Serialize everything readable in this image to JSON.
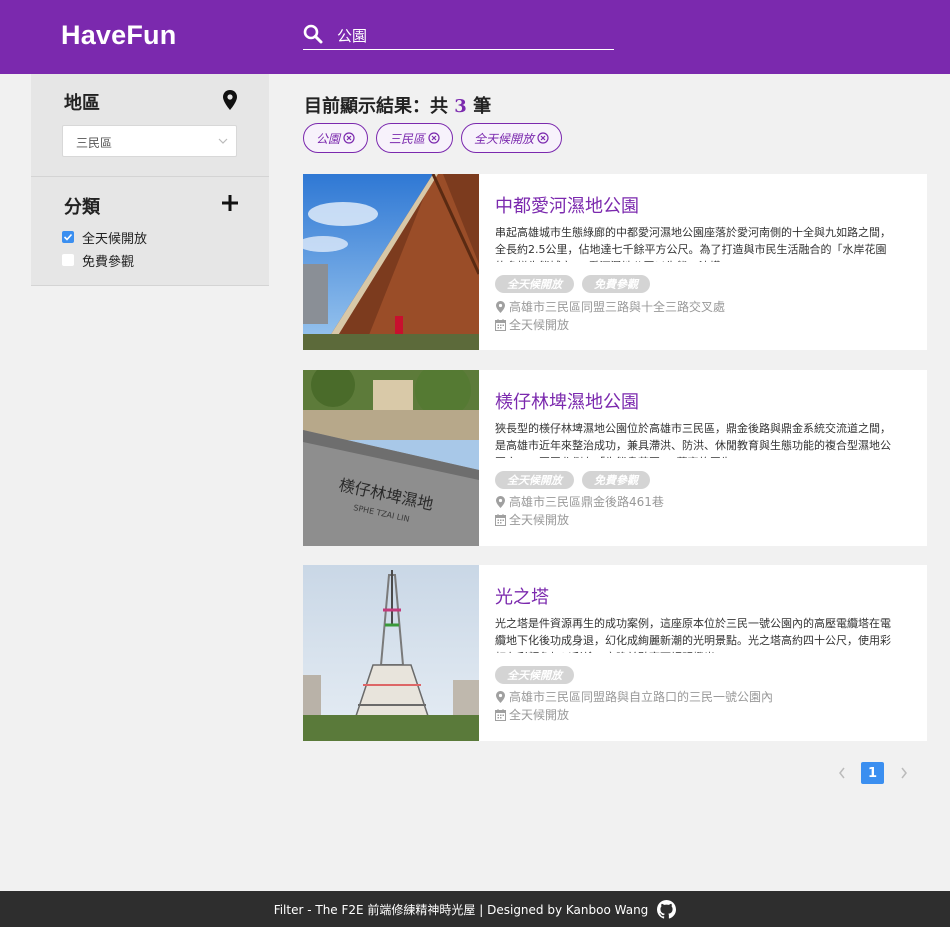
{
  "header": {
    "logo": "HaveFun",
    "search_value": "公園"
  },
  "sidebar": {
    "region_title": "地區",
    "region_select": "三民區",
    "category_title": "分類",
    "categories": [
      {
        "label": "全天候開放",
        "checked": true
      },
      {
        "label": "免費參觀",
        "checked": false
      }
    ]
  },
  "results": {
    "prefix": "目前顯示結果：共 ",
    "count": "3",
    "suffix": " 筆"
  },
  "filters": [
    "公園",
    "三民區",
    "全天候開放"
  ],
  "places": [
    {
      "name": "中都愛河濕地公園",
      "desc": "串起高雄城市生態綠廊的中都愛河濕地公園座落於愛河南側的十全與九如路之間，全長約2.5公里，佔地達七千餘平方公尺。為了打造與市民生活融合的「水岸花園的多樣生態城市」，愛河濕地公園以生態工法構",
      "tags": [
        "全天候開放",
        "免費參觀"
      ],
      "address": "高雄市三民區同盟三路與十全三路交叉處",
      "hours": "全天候開放"
    },
    {
      "name": "檨仔林埤濕地公園",
      "desc": "狹長型的檨仔林埤濕地公園位於高雄市三民區，鼎金後路與鼎金系統交流道之間，是高雄市近年來整治成功，兼具滯洪、防洪、休閒教育與生態功能的複合型濕地公園之一。園區北側有「生態島花園」，蘊育的原生",
      "tags": [
        "全天候開放",
        "免費參觀"
      ],
      "address": "高雄市三民區鼎金後路461巷",
      "hours": "全天候開放"
    },
    {
      "name": "光之塔",
      "desc": "光之塔是件資源再生的成功案例，這座原本位於三民一號公園內的高壓電纜塔在電纜地下化後功成身退，幻化成絢麗新潮的光明景點。光之塔高約四十公尺，使用彩虹七彩顏色加以彩繪，夜晚並點亮可調明燈光",
      "tags": [
        "全天候開放"
      ],
      "address": "高雄市三民區同盟路與自立路口的三民一號公園內",
      "hours": "全天候開放"
    }
  ],
  "pagination": {
    "current": "1"
  },
  "footer": {
    "text": "Filter - The F2E 前端修練精神時光屋 | Designed by Kanboo Wang"
  },
  "colors": {
    "brand": "#7b29ae",
    "accent": "#3b8ff0",
    "tag_bg": "#d4d4d4",
    "footer_bg": "#2e2e2e"
  }
}
